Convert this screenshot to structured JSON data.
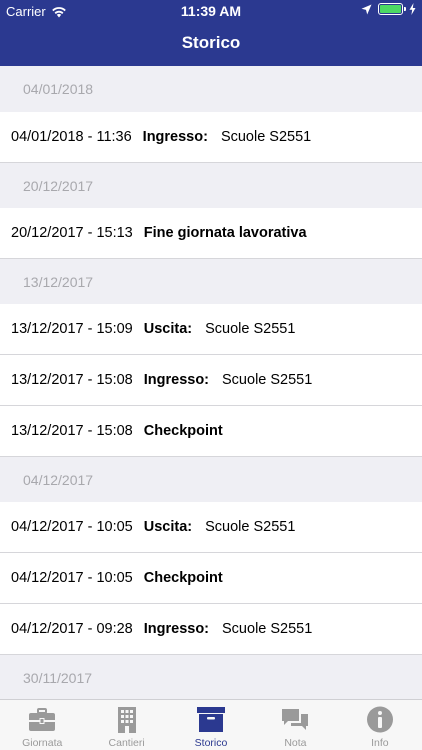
{
  "status_bar": {
    "carrier": "Carrier",
    "time": "11:39 AM",
    "battery_level": 1.0
  },
  "nav": {
    "title": "Storico"
  },
  "sections": [
    {
      "date": "04/01/2018",
      "rows": [
        {
          "date": "04/01/2018 - 11:36",
          "kind": "Ingresso:",
          "detail": "Scuole S2551"
        }
      ]
    },
    {
      "date": "20/12/2017",
      "rows": [
        {
          "date": "20/12/2017 - 15:13",
          "kind": "Fine giornata lavorativa",
          "detail": ""
        }
      ]
    },
    {
      "date": "13/12/2017",
      "rows": [
        {
          "date": "13/12/2017 - 15:09",
          "kind": "Uscita:",
          "detail": "Scuole S2551"
        },
        {
          "date": "13/12/2017 - 15:08",
          "kind": "Ingresso:",
          "detail": "Scuole S2551"
        },
        {
          "date": "13/12/2017 - 15:08",
          "kind": "Checkpoint",
          "detail": ""
        }
      ]
    },
    {
      "date": "04/12/2017",
      "rows": [
        {
          "date": "04/12/2017 - 10:05",
          "kind": "Uscita:",
          "detail": "Scuole S2551"
        },
        {
          "date": "04/12/2017 - 10:05",
          "kind": "Checkpoint",
          "detail": ""
        },
        {
          "date": "04/12/2017 - 09:28",
          "kind": "Ingresso:",
          "detail": "Scuole S2551"
        }
      ]
    },
    {
      "date": "30/11/2017",
      "rows": []
    }
  ],
  "tabs": [
    {
      "label": "Giornata",
      "icon": "briefcase-icon",
      "active": false
    },
    {
      "label": "Cantieri",
      "icon": "building-icon",
      "active": false
    },
    {
      "label": "Storico",
      "icon": "archive-box-icon",
      "active": true
    },
    {
      "label": "Nota",
      "icon": "chat-bubbles-icon",
      "active": false
    },
    {
      "label": "Info",
      "icon": "info-icon",
      "active": false
    }
  ],
  "colors": {
    "accent": "#2b3990",
    "section_bg": "#efeff4",
    "section_text": "#a8a8ad",
    "tab_inactive": "#9a9a9a"
  }
}
